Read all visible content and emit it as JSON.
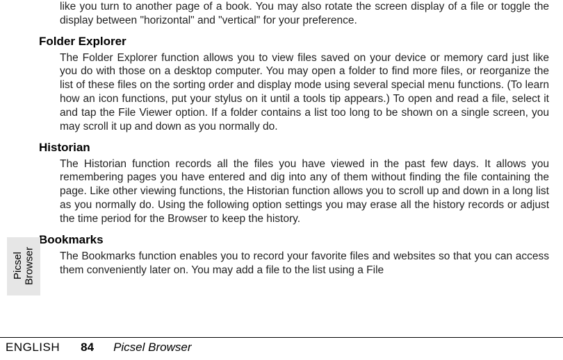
{
  "sections": {
    "intro_fragment": "like you turn to another page of a book. You may also rotate the screen display of a file or toggle the display between \"horizontal\" and \"vertical\" for your preference.",
    "folder_explorer": {
      "heading": "Folder Explorer",
      "body": "The Folder Explorer function allows you to view files saved on your device or memory card just like you do with those on a desktop computer. You may open a folder to find more files, or reorganize the list of these files on the sorting order and display mode using several special menu functions. (To learn how an icon functions, put your stylus on it until a tools tip appears.) To open and read a file, select it and tap the File Viewer option. If a folder contains a list too long to be shown on a single screen, you may scroll it up and down as you normally do."
    },
    "historian": {
      "heading": "Historian",
      "body": "The Historian function records all the files you have viewed in the past few days. It allows you remembering pages you have entered and dig into any of them without finding the file containing the page. Like other viewing functions, the Historian function allows you to scroll up and down in a long list as you normally do. Using the following option settings you may erase all the history records or adjust the time period for the Browser to keep the history."
    },
    "bookmarks": {
      "heading": "Bookmarks",
      "body": "The Bookmarks function enables you to record your favorite files and websites so that you can access them conveniently later on. You may add a file to the list using a File"
    }
  },
  "side_tab": "Picsel\nBrowser",
  "footer": {
    "language": "ENGLISH",
    "page_number": "84",
    "title": "Picsel Browser"
  }
}
